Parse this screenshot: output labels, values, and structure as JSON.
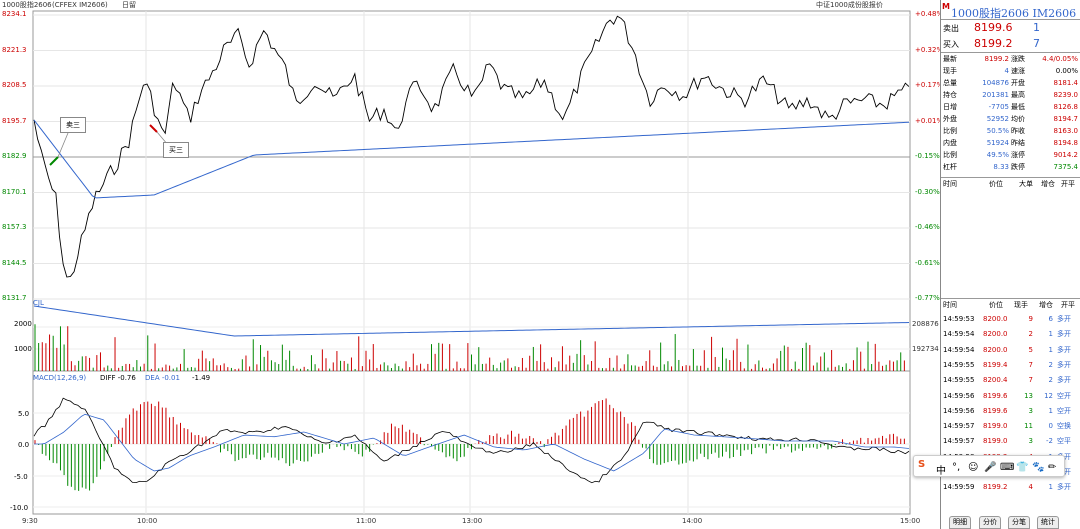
{
  "topbar": {
    "title": "1000股指2606",
    "code": "(CFFEX IM2606)",
    "period": "日留",
    "index_name": "中证1000成份股报价"
  },
  "y_left": [
    "8234.1",
    "8221.3",
    "8208.5",
    "8195.7",
    "8182.9",
    "8170.1",
    "8157.3",
    "8144.5",
    "8131.7"
  ],
  "y_right": [
    "+0.48%",
    "+0.32%",
    "+0.17%",
    "+0.01%",
    "-0.15%",
    "-0.30%",
    "-0.46%",
    "-0.61%",
    "-0.77%"
  ],
  "x_labels": [
    "9:30",
    "10:00",
    "11:00",
    "13:00",
    "14:00",
    "15:00"
  ],
  "annotations": {
    "sell": "卖三",
    "buy": "买三"
  },
  "volume": {
    "label": "CJL",
    "ticks": [
      "2000",
      "1000"
    ],
    "right_top": "208876",
    "right_mid": "192734"
  },
  "macd": {
    "label": "MACD(12,26,9)",
    "diff": "DIFF -0.76",
    "dea": "DEA -0.01",
    "val": "-1.49",
    "ticks": [
      "5.0",
      "0.0",
      "-5.0",
      "-10.0"
    ]
  },
  "panel": {
    "m": "M",
    "name": "1000股指2606  IM2606",
    "sell_label": "卖出",
    "sell_price": "8199.6",
    "sell_vol": "1",
    "buy_label": "买入",
    "buy_price": "8199.2",
    "buy_vol": "7",
    "stats": [
      [
        "最新",
        "8199.2",
        "涨跌",
        "4.4/0.05%"
      ],
      [
        "现手",
        "4",
        "速涨",
        "0.00%"
      ],
      [
        "总量",
        "104876",
        "开盘",
        "8181.4"
      ],
      [
        "持仓",
        "201381",
        "最高",
        "8239.0"
      ],
      [
        "日增",
        "-7705",
        "最低",
        "8126.8"
      ],
      [
        "外盘",
        "52952",
        "均价",
        "8194.7"
      ],
      [
        "比例",
        "50.5%",
        "昨收",
        "8163.0"
      ],
      [
        "内盘",
        "51924",
        "昨结",
        "8194.8"
      ],
      [
        "比例",
        "49.5%",
        "涨停",
        "9014.2"
      ],
      [
        "杠杆",
        "8.33",
        "跌停",
        "7375.4"
      ]
    ],
    "header1": [
      "时间",
      "价位",
      "大单",
      "增仓",
      "开平"
    ],
    "header2": [
      "时间",
      "价位",
      "现手",
      "增仓",
      "开平"
    ],
    "ticks": [
      [
        "14:59:53",
        "8200.0",
        "9",
        "6",
        "多开"
      ],
      [
        "14:59:54",
        "8200.0",
        "2",
        "1",
        "多开"
      ],
      [
        "14:59:54",
        "8200.0",
        "5",
        "1",
        "多开"
      ],
      [
        "14:59:55",
        "8199.4",
        "7",
        "2",
        "多开"
      ],
      [
        "14:59:55",
        "8200.4",
        "7",
        "2",
        "多开"
      ],
      [
        "14:59:56",
        "8199.6",
        "13",
        "12",
        "空开"
      ],
      [
        "14:59:56",
        "8199.6",
        "3",
        "1",
        "空开"
      ],
      [
        "14:59:57",
        "8199.0",
        "11",
        "0",
        "空换"
      ],
      [
        "14:59:57",
        "8199.0",
        "3",
        "-2",
        "空平"
      ],
      [
        "14:59:58",
        "8199.2",
        "4",
        "1",
        "多开"
      ],
      [
        "14:59:59",
        "8199.6",
        "5",
        "2",
        "多开"
      ],
      [
        "14:59:59",
        "8199.2",
        "4",
        "1",
        "多开"
      ]
    ],
    "tabs": [
      "明细",
      "分价",
      "分笔",
      "统计"
    ]
  },
  "ime": {
    "items": [
      "中",
      "°,",
      "☺",
      "🎤",
      "⌨",
      "👕",
      "🐾",
      "✏"
    ]
  },
  "colors": {
    "up": "#cc0000",
    "down": "#008800",
    "avg": "#3366cc",
    "diff": "#000000",
    "dea": "#3366cc"
  }
}
